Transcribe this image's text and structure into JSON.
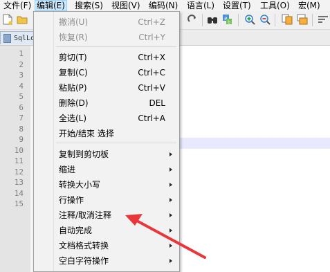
{
  "menubar": {
    "items": [
      {
        "label": "文件(F)"
      },
      {
        "label": "编辑(E)"
      },
      {
        "label": "搜索(S)"
      },
      {
        "label": "视图(V)"
      },
      {
        "label": "编码(N)"
      },
      {
        "label": "语言(L)"
      },
      {
        "label": "设置(T)"
      },
      {
        "label": "工具(O)"
      },
      {
        "label": "宏(M)"
      }
    ],
    "active_index": 1
  },
  "toolbar": {
    "icons": [
      "new-file-icon",
      "open-folder-icon",
      "redo-icon",
      "find-binoculars-icon",
      "find-replace-icon",
      "zoom-in-icon",
      "zoom-out-icon",
      "sync-vertical-icon",
      "sync-horizontal-icon",
      "word-wrap-icon"
    ]
  },
  "tabs": [
    {
      "label": "SqlLo"
    }
  ],
  "editor": {
    "line_numbers": [
      "1",
      "2",
      "3",
      "4",
      "5",
      "6",
      "7",
      "8",
      "9",
      "10",
      "11",
      "12",
      "13",
      "14",
      "15"
    ],
    "current_line": 9
  },
  "edit_menu": {
    "items": [
      {
        "label": "撤消(U)",
        "shortcut": "Ctrl+Z",
        "disabled": true,
        "submenu": false
      },
      {
        "label": "恢复(R)",
        "shortcut": "Ctrl+Y",
        "disabled": true,
        "submenu": false
      },
      {
        "label": "剪切(T)",
        "shortcut": "Ctrl+X",
        "disabled": false,
        "submenu": false
      },
      {
        "label": "复制(C)",
        "shortcut": "Ctrl+C",
        "disabled": false,
        "submenu": false
      },
      {
        "label": "粘贴(P)",
        "shortcut": "Ctrl+V",
        "disabled": false,
        "submenu": false
      },
      {
        "label": "删除(D)",
        "shortcut": "DEL",
        "disabled": false,
        "submenu": false
      },
      {
        "label": "全选(L)",
        "shortcut": "Ctrl+A",
        "disabled": false,
        "submenu": false
      },
      {
        "label": "开始/结束 选择",
        "shortcut": "",
        "disabled": false,
        "submenu": false
      },
      {
        "label": "复制到剪切板",
        "shortcut": "",
        "disabled": false,
        "submenu": true
      },
      {
        "label": "缩进",
        "shortcut": "",
        "disabled": false,
        "submenu": true
      },
      {
        "label": "转换大小写",
        "shortcut": "",
        "disabled": false,
        "submenu": true
      },
      {
        "label": "行操作",
        "shortcut": "",
        "disabled": false,
        "submenu": true
      },
      {
        "label": "注释/取消注释",
        "shortcut": "",
        "disabled": false,
        "submenu": true
      },
      {
        "label": "自动完成",
        "shortcut": "",
        "disabled": false,
        "submenu": true
      },
      {
        "label": "文档格式转换",
        "shortcut": "",
        "disabled": false,
        "submenu": true
      },
      {
        "label": "空白字符操作",
        "shortcut": "",
        "disabled": false,
        "submenu": true
      }
    ]
  },
  "colors": {
    "menu_active_bg": "#cce8ff",
    "annotation_arrow": "#e8363b",
    "disabled_text": "#8d8d8d"
  }
}
